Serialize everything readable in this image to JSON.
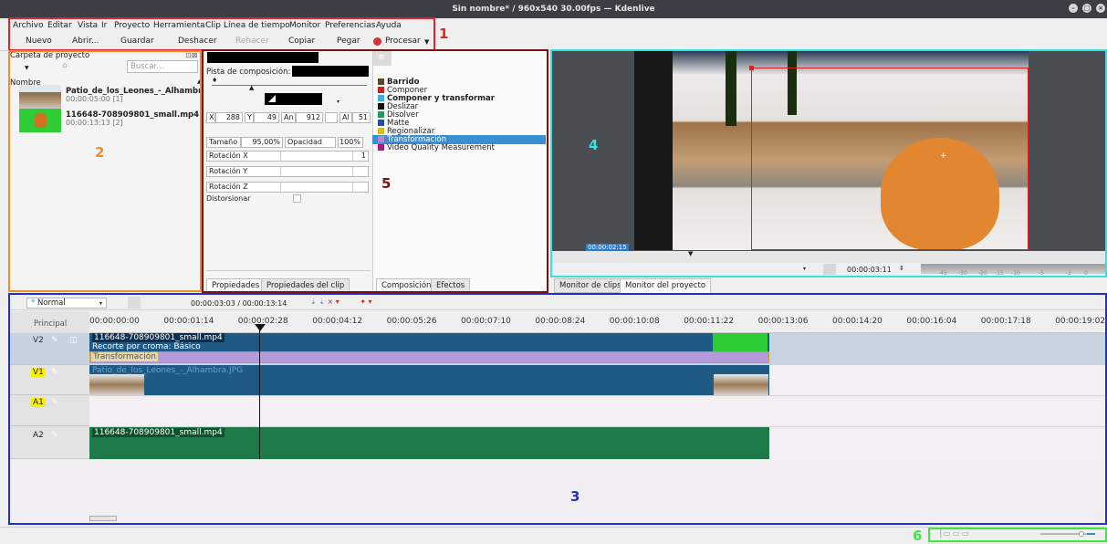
{
  "window": {
    "title": "Sin nombre* / 960x540 30.00fps — Kdenlive"
  },
  "menu": [
    "Archivo",
    "Editar",
    "Vista",
    "Ir",
    "Proyecto",
    "Herramienta",
    "Clip",
    "Línea de tiempo",
    "Monitor",
    "Preferencias",
    "Ayuda"
  ],
  "toolbar": {
    "nuevo": "Nuevo",
    "abrir": "Abrir...",
    "guardar": "Guardar",
    "deshacer": "Deshacer",
    "rehacer": "Rehacer",
    "copiar": "Copiar",
    "pegar": "Pegar",
    "procesar": "Procesar"
  },
  "annotations": [
    "1",
    "2",
    "3",
    "4",
    "5",
    "6"
  ],
  "bin": {
    "title": "Carpeta de proyecto",
    "search_placeholder": "Buscar...",
    "column": "Nombre",
    "items": [
      {
        "name": "Patio_de_los_Leones_-_Alhambra.JPG",
        "meta": "00:00:05:00 [1]"
      },
      {
        "name": "116648-708909801_small.mp4",
        "meta": "00:00:13:13 [2]"
      }
    ]
  },
  "props": {
    "track_label": "Pista de composición:",
    "x_label": "X",
    "x_value": "288",
    "y_label": "Y",
    "y_value": "49",
    "w_label": "An",
    "w_value": "912",
    "h_label": "Al",
    "h_value": "51",
    "size_label": "Tamaño",
    "size_value": "95,00%",
    "opacity_label": "Opacidad",
    "opacity_value": "100%",
    "rot_x": "Rotación X",
    "rot_x_value": "1",
    "rot_y": "Rotación Y",
    "rot_z": "Rotación Z",
    "distort": "Distorsionar",
    "tab_props": "Propiedades",
    "tab_clip_props": "Propiedades del clip"
  },
  "transitions": {
    "items": [
      {
        "label": "Barrido",
        "bold": true,
        "color": "#5a4a2a"
      },
      {
        "label": "Componer",
        "bold": false,
        "color": "#d02020"
      },
      {
        "label": "Componer y transformar",
        "bold": true,
        "color": "#40b0d0"
      },
      {
        "label": "Deslizar",
        "bold": false,
        "color": "#111111"
      },
      {
        "label": "Disolver",
        "bold": false,
        "color": "#2a9a5a"
      },
      {
        "label": "Matte",
        "bold": false,
        "color": "#2050a0"
      },
      {
        "label": "Regionalizar",
        "bold": false,
        "color": "#d0c020"
      },
      {
        "label": "Transformación",
        "bold": false,
        "color": "#c080d0",
        "selected": true
      },
      {
        "label": "Video Quality Measurement",
        "bold": false,
        "color": "#a02080"
      }
    ],
    "tab_composicion": "Composición",
    "tab_efectos": "Efectos"
  },
  "monitor": {
    "timecode_overlay": "00:00:02:15",
    "timecode": "00:00:03:11",
    "meter_labels": [
      "-45",
      "-30",
      "-20",
      "-15",
      "-10",
      "-5",
      "-2",
      "0"
    ],
    "tab_clip": "Monitor de clips",
    "tab_project": "Monitor del proyecto"
  },
  "timeline": {
    "mode": "Normal",
    "position": "00:00:03:03 / 00:00:13:14",
    "principal": "Principal",
    "ruler": [
      "00:00:00:00",
      "00:00:01:14",
      "00:00:02:28",
      "00:00:04:12",
      "00:00:05:26",
      "00:00:07:10",
      "00:00:08:24",
      "00:00:10:08",
      "00:00:11:22",
      "00:00:13:06",
      "00:00:14:20",
      "00:00:16:04",
      "00:00:17:18",
      "00:00:19:02"
    ],
    "tracks": [
      "V2",
      "V1",
      "A1",
      "A2"
    ],
    "v2_clip": "116648-708909801_small.mp4",
    "v2_effect": "Recorte por croma: Básico",
    "composition": "Transformación",
    "v1_clip": "Patio_de_los_Leones_-_Alhambra.JPG",
    "a2_clip": "116648-708909801_small.mp4"
  },
  "colors": {
    "annot_red": "#e8202a",
    "annot_orange": "#f28c28",
    "annot_darkred": "#7a1010",
    "annot_cyan": "#35e0e6",
    "annot_blue": "#2030d0",
    "annot_green": "#3ee83e",
    "clip_video": "#1f5a85",
    "clip_audio": "#1f7a4a",
    "composition": "#b49ad8",
    "selection": "#3a8fd0"
  }
}
